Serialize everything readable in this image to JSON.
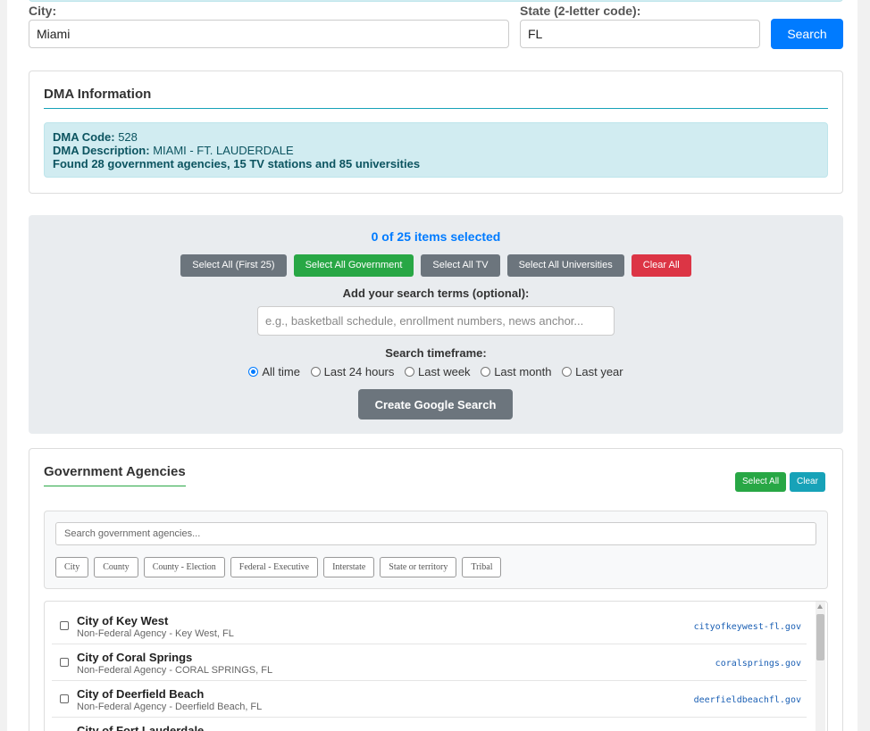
{
  "location": {
    "city_label": "City:",
    "city_value": "Miami",
    "state_label": "State (2-letter code):",
    "state_value": "FL",
    "search_button": "Search"
  },
  "dma": {
    "title": "DMA Information",
    "code_label": "DMA Code:",
    "code_value": "528",
    "desc_label": "DMA Description:",
    "desc_value": "MIAMI - FT. LAUDERDALE",
    "found_text": "Found 28 government agencies, 15 TV stations and 85 universities"
  },
  "selection": {
    "count_text": "0 of 25 items selected",
    "buttons": {
      "select_first": "Select All (First 25)",
      "select_gov": "Select All Government",
      "select_tv": "Select All TV",
      "select_univ": "Select All Universities",
      "clear_all": "Clear All"
    },
    "terms_label": "Add your search terms (optional):",
    "terms_placeholder": "e.g., basketball schedule, enrollment numbers, news anchor...",
    "timeframe_label": "Search timeframe:",
    "timeframes": [
      "All time",
      "Last 24 hours",
      "Last week",
      "Last month",
      "Last year"
    ],
    "selected_timeframe": "All time",
    "create_button": "Create Google Search"
  },
  "government": {
    "title": "Government Agencies",
    "select_all": "Select All",
    "clear": "Clear",
    "filter_placeholder": "Search government agencies...",
    "filters": [
      "City",
      "County",
      "County - Election",
      "Federal - Executive",
      "Interstate",
      "State or territory",
      "Tribal"
    ],
    "agencies": [
      {
        "name": "City of Key West",
        "sub": "Non-Federal Agency - Key West, FL",
        "domain": "cityofkeywest-fl.gov"
      },
      {
        "name": "City of Coral Springs",
        "sub": "Non-Federal Agency - CORAL SPRINGS, FL",
        "domain": "coralsprings.gov"
      },
      {
        "name": "City of Deerfield Beach",
        "sub": "Non-Federal Agency - Deerfield Beach, FL",
        "domain": "deerfieldbeachfl.gov"
      },
      {
        "name": "City of Fort Lauderdale",
        "sub": "",
        "domain": ""
      }
    ]
  },
  "colors": {
    "primary": "#007bff",
    "success": "#28a745",
    "danger": "#dc3545",
    "info": "#17a2b8",
    "secondary": "#6c757d"
  }
}
